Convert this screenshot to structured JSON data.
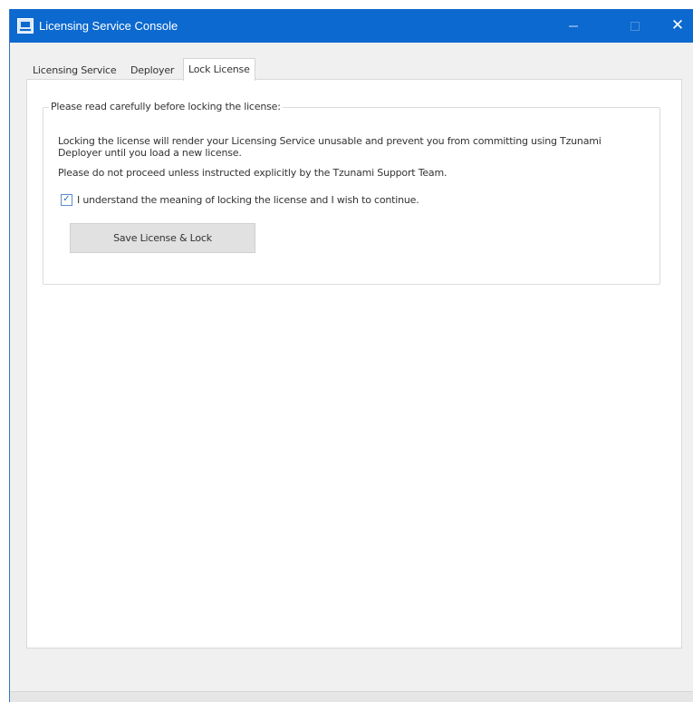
{
  "window": {
    "title": "Licensing Service Console",
    "accent_color": "#0c69cf",
    "controls": {
      "minimize_icon": "minimize-icon",
      "maximize_icon": "maximize-icon",
      "close_glyph": "✕"
    }
  },
  "tabs": [
    {
      "label": "Licensing Service",
      "selected": false
    },
    {
      "label": "Deployer",
      "selected": false
    },
    {
      "label": "Lock License",
      "selected": true
    }
  ],
  "lock_license": {
    "group_title": "Please read carefully before locking the license:",
    "paragraph_1": "Locking the license will render your Licensing Service unusable and prevent you from committing using Tzunami Deployer until you load a new license.",
    "paragraph_2": "Please do not proceed unless instructed explicitly by the Tzunami Support Team.",
    "confirm_checkbox": {
      "label": "I understand the meaning of locking the license and I wish to continue.",
      "checked": true,
      "mark": "✓"
    },
    "save_button_label": "Save License & Lock"
  }
}
